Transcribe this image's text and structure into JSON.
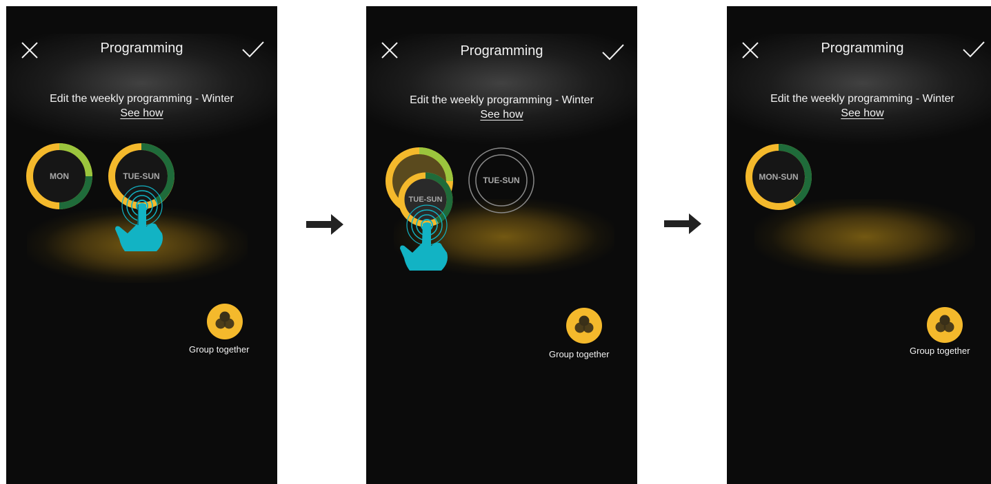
{
  "screens": [
    {
      "header": {
        "title": "Programming",
        "close_icon": "close-icon",
        "confirm_icon": "checkmark-icon"
      },
      "subtitle": "Edit the weekly programming - Winter",
      "see_how": "See how",
      "rings": [
        {
          "label": "MON"
        },
        {
          "label": "TUE-SUN"
        }
      ],
      "group": {
        "label": "Group together",
        "icon": "group-circles-icon"
      }
    },
    {
      "header": {
        "title": "Programming",
        "close_icon": "close-icon",
        "confirm_icon": "checkmark-icon"
      },
      "subtitle": "Edit the weekly programming - Winter",
      "see_how": "See how",
      "rings": [
        {
          "label": "TUE-SUN"
        },
        {
          "label": "TUE-SUN"
        }
      ],
      "group": {
        "label": "Group together",
        "icon": "group-circles-icon"
      }
    },
    {
      "header": {
        "title": "Programming",
        "close_icon": "close-icon",
        "confirm_icon": "checkmark-icon"
      },
      "subtitle": "Edit the weekly programming - Winter",
      "see_how": "See how",
      "rings": [
        {
          "label": "MON-SUN"
        }
      ],
      "group": {
        "label": "Group together",
        "icon": "group-circles-icon"
      }
    }
  ],
  "colors": {
    "background": "#0b0b0b",
    "yellow": "#f4b92c",
    "light_green": "#9bc53d",
    "dark_green": "#1f6b3a",
    "hand": "#12b3c4",
    "arrow": "#222222"
  }
}
